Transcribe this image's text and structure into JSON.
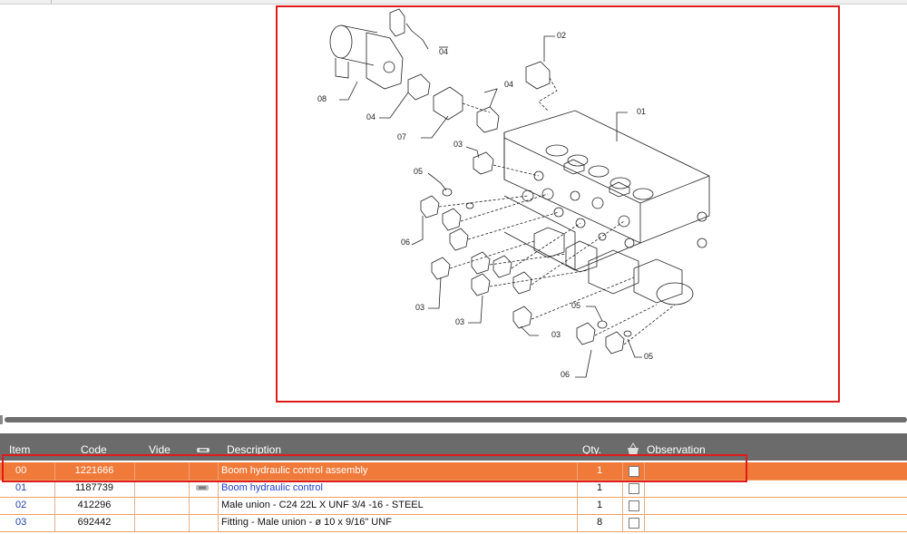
{
  "diagram": {
    "callouts": [
      "01",
      "02",
      "03",
      "03",
      "03",
      "03",
      "04",
      "04",
      "04",
      "05",
      "05",
      "05",
      "06",
      "06",
      "07",
      "08"
    ]
  },
  "table": {
    "headers": {
      "item": "Item",
      "code": "Code",
      "vide": "Vide",
      "description": "Description",
      "qty": "Qty.",
      "observation": "Observation"
    },
    "header_icons": [
      "link-icon",
      "basket-icon"
    ],
    "rows": [
      {
        "item": "00",
        "code": "1221666",
        "description": "Boom hydraulic control assembly",
        "qty": "1",
        "selected": true
      },
      {
        "item": "01",
        "code": "1187739",
        "description": "Boom hydraulic control",
        "qty": "1",
        "link": true
      },
      {
        "item": "02",
        "code": "412296",
        "description": "Male union - C24 22L X UNF 3/4 -16 - STEEL",
        "qty": "1"
      },
      {
        "item": "03",
        "code": "692442",
        "description": "Fitting - Male union - ø 10 x 9/16\" UNF",
        "qty": "8"
      }
    ]
  },
  "colors": {
    "selected_row": "#f07a3a",
    "header_bg": "#6b6b6b",
    "highlight": "#e01b1b",
    "link": "#1f3fcc"
  }
}
